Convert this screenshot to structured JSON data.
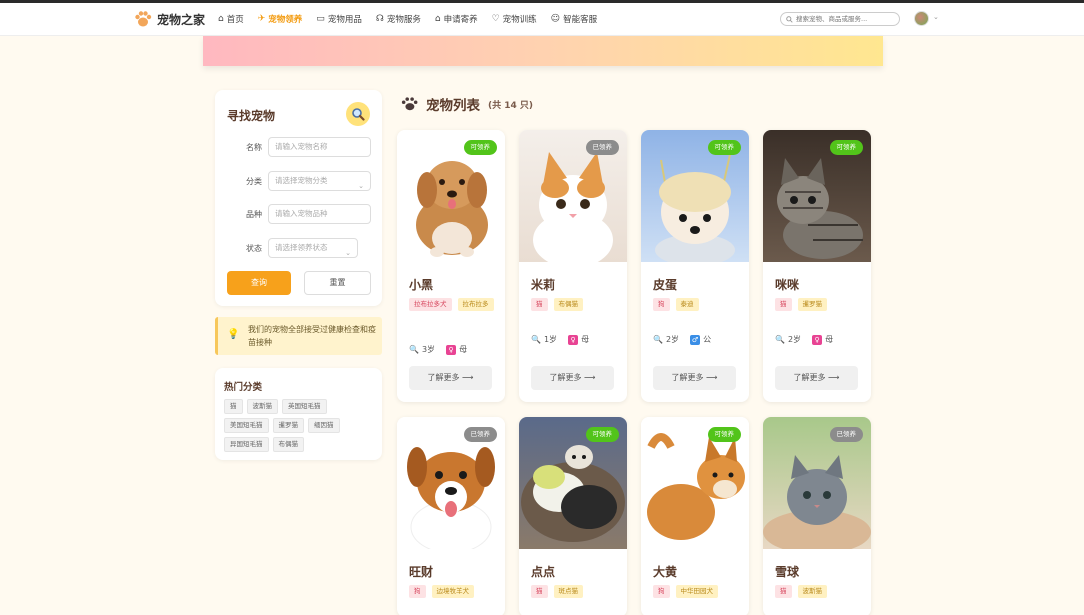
{
  "header": {
    "site_name": "宠物之家",
    "menu": [
      {
        "icon": "⌂",
        "label": "首页"
      },
      {
        "icon": "✈",
        "label": "宠物领养"
      },
      {
        "icon": "▭",
        "label": "宠物用品"
      },
      {
        "icon": "☊",
        "label": "宠物服务"
      },
      {
        "icon": "⌂",
        "label": "申请寄养"
      },
      {
        "icon": "♡",
        "label": "宠物训练"
      },
      {
        "icon": "☺",
        "label": "智能客服"
      }
    ],
    "search_placeholder": "搜索宠物、商品或服务..."
  },
  "filter": {
    "title": "寻找宠物",
    "fields": [
      {
        "label": "名称",
        "placeholder": "请输入宠物名称"
      },
      {
        "label": "分类",
        "placeholder": "请选择宠物分类"
      },
      {
        "label": "品种",
        "placeholder": "请输入宠物品种"
      },
      {
        "label": "状态",
        "placeholder": "请选择领养状态"
      }
    ],
    "query_label": "查询",
    "reset_label": "重置"
  },
  "tip": "我们的宠物全部接受过健康检查和疫苗接种",
  "hot": {
    "title": "热门分类",
    "tags": [
      "猫",
      "波斯猫",
      "英国短毛猫",
      "美国短毛猫",
      "暹罗猫",
      "缅因猫",
      "异国短毛猫",
      "布偶猫"
    ]
  },
  "list": {
    "title": "宠物列表",
    "count": "(共 14 只)"
  },
  "pets": [
    {
      "name": "小黑",
      "status": "可领养",
      "tags": [
        "拉布拉多犬",
        "拉布拉多"
      ],
      "age": "3岁",
      "gender": "母",
      "more": "了解更多 ⟶"
    },
    {
      "name": "米莉",
      "status": "已领养",
      "tags": [
        "猫",
        "布偶猫"
      ],
      "age": "1岁",
      "gender": "母",
      "more": "了解更多 ⟶"
    },
    {
      "name": "皮蛋",
      "status": "可领养",
      "tags": [
        "狗",
        "泰迪"
      ],
      "age": "2岁",
      "gender": "公",
      "more": "了解更多 ⟶"
    },
    {
      "name": "咪咪",
      "status": "可领养",
      "tags": [
        "猫",
        "暹罗猫"
      ],
      "age": "2岁",
      "gender": "母",
      "more": "了解更多 ⟶"
    },
    {
      "name": "旺财",
      "status": "已领养",
      "tags": [
        "狗",
        "边境牧羊犬"
      ]
    },
    {
      "name": "点点",
      "status": "可领养",
      "tags": [
        "猫",
        "斑点猫"
      ]
    },
    {
      "name": "大黄",
      "status": "可领养",
      "tags": [
        "狗",
        "中华田园犬"
      ]
    },
    {
      "name": "雪球",
      "status": "已领养",
      "tags": [
        "猫",
        "波斯猫"
      ]
    }
  ]
}
